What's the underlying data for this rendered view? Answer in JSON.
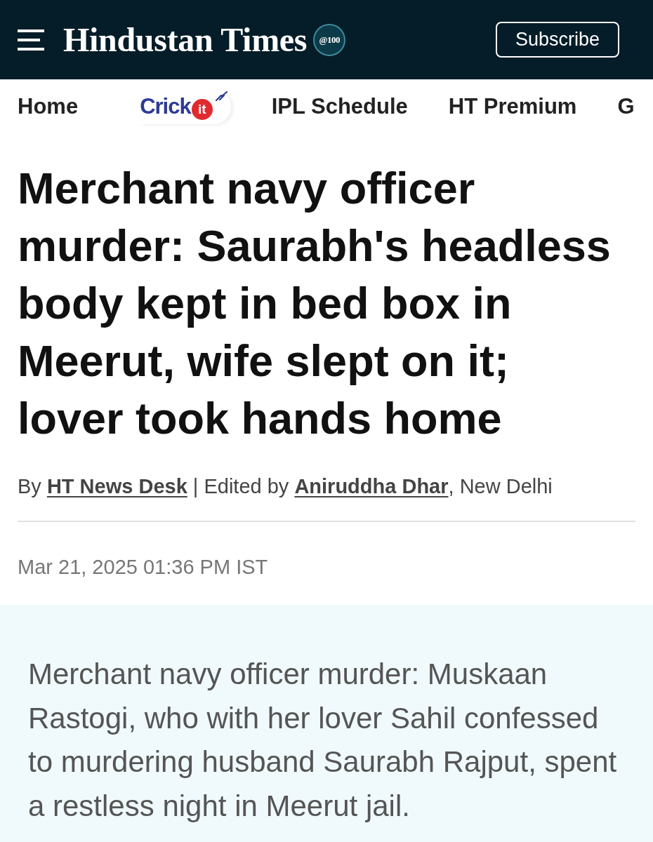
{
  "header": {
    "logo": "Hindustan Times",
    "badge": "@100",
    "subscribe": "Subscribe"
  },
  "nav": [
    {
      "kind": "text",
      "label": "Home"
    },
    {
      "kind": "logo",
      "label": "Crick",
      "badge": "it"
    },
    {
      "kind": "text",
      "label": "IPL Schedule"
    },
    {
      "kind": "text",
      "label": "HT Premium"
    },
    {
      "kind": "text",
      "label": "G"
    }
  ],
  "headline": "Merchant navy officer murder: Saurabh's headless body kept in bed box in Meerut, wife slept on it; lover took hands home",
  "byline": {
    "prefix": "By",
    "author": "HT News Desk",
    "separator": "| Edited by",
    "editor": "Aniruddha Dhar",
    "suffix": ", New Delhi"
  },
  "timestamp": "Mar 21, 2025 01:36 PM IST",
  "summary": "Merchant navy officer murder: Muskaan Rastogi, who with her lover Sahil confessed to murdering husband Saurabh Rajput, spent a restless night in Meerut jail."
}
